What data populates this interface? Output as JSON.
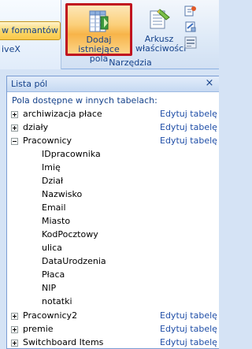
{
  "ribbon": {
    "left_button_label": "w formantów",
    "activex_label": "iveX",
    "add_fields_label": "Dodaj istniejące pola",
    "properties_label": "Arkusz właściwości",
    "group_label": "Narzędzia"
  },
  "panel": {
    "title": "Lista pól",
    "close_glyph": "×",
    "section_label": "Pola dostępne w innych tabelach:",
    "edit_label": "Edytuj tabelę",
    "tables": [
      {
        "name": "archiwizacja płace",
        "expanded": false
      },
      {
        "name": "działy",
        "expanded": false
      },
      {
        "name": "Pracownicy",
        "expanded": true,
        "fields": [
          "IDpracownika",
          "Imię",
          "Dział",
          "Nazwisko",
          "Email",
          "Miasto",
          "KodPocztowy",
          "ulica",
          "DataUrodzenia",
          "Płaca",
          "NIP",
          "notatki"
        ]
      },
      {
        "name": "Pracownicy2",
        "expanded": false
      },
      {
        "name": "premie",
        "expanded": false
      },
      {
        "name": "Switchboard Items",
        "expanded": false
      }
    ]
  },
  "colors": {
    "accent_border": "#c0141f",
    "link": "#1f4ea7",
    "ribbon_text": "#15428b"
  },
  "icons": [
    "add-fields-icon",
    "property-sheet-icon",
    "tab-order-icon",
    "subform-icon",
    "convert-macros-icon",
    "close-icon",
    "expand-icon",
    "collapse-icon"
  ]
}
